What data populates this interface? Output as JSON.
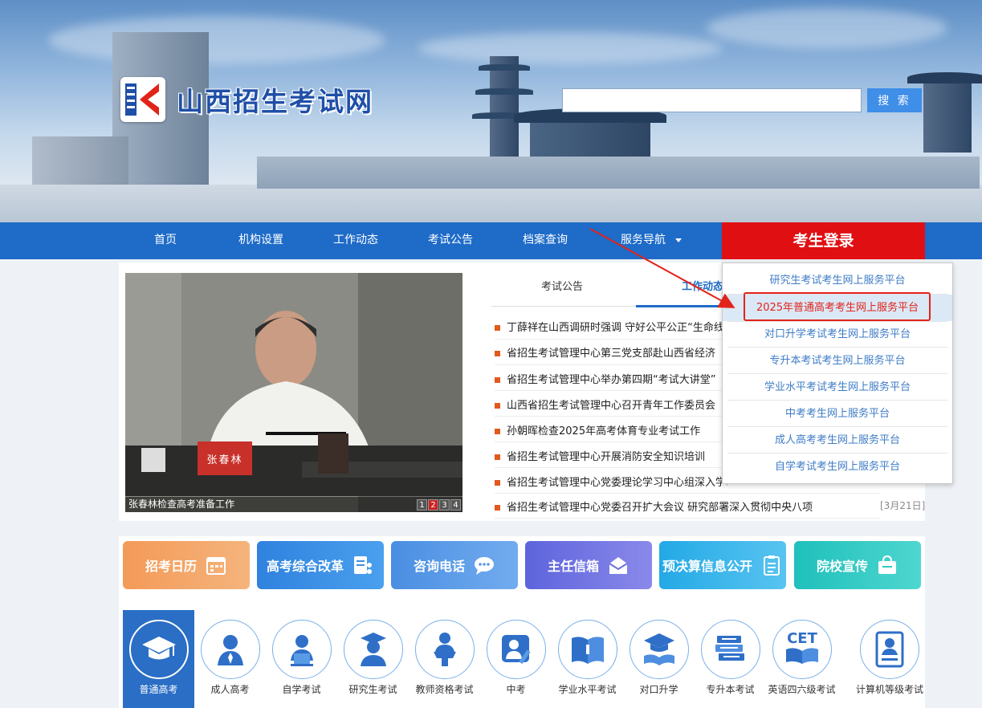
{
  "site": {
    "title": "山西招生考试网"
  },
  "search": {
    "placeholder": "",
    "button_label": "搜 索"
  },
  "nav": {
    "items": [
      "首页",
      "机构设置",
      "工作动态",
      "考试公告",
      "档案查询",
      "服务导航"
    ],
    "login_label": "考生登录"
  },
  "photo": {
    "caption": "张春林检查高考准备工作",
    "name_card": "张春林",
    "pages": [
      "1",
      "2",
      "3",
      "4"
    ],
    "active_page": "2"
  },
  "tabs": {
    "first": "考试公告",
    "second": "工作动态"
  },
  "news": [
    "丁薛祥在山西调研时强调 守好公平公正“生命线”",
    "省招生考试管理中心第三党支部赴山西省经济",
    "省招生考试管理中心举办第四期“考试大讲堂”",
    "山西省招生考试管理中心召开青年工作委员会",
    "孙朝晖检查2025年高考体育专业考试工作",
    "省招生考试管理中心开展消防安全知识培训",
    "省招生考试管理中心党委理论学习中心组深入学习",
    "省招生考试管理中心党委召开扩大会议 研究部署深入贯彻中央八项"
  ],
  "news_last_date": "[3月21日]",
  "dropdown": {
    "items": [
      "研究生考试考生网上服务平台",
      "2025年普通高考考生网上服务平台",
      "对口升学考试考生网上服务平台",
      "专升本考试考生网上服务平台",
      "学业水平考试考生网上服务平台",
      "中考考生网上服务平台",
      "成人高考考生网上服务平台",
      "自学考试考生网上服务平台"
    ],
    "highlighted_index": 1
  },
  "tiles": [
    {
      "label": "招考日历",
      "icon": "calendar-icon",
      "color": "#f2a766"
    },
    {
      "label": "高考综合改革",
      "icon": "share-doc-icon",
      "color": "#3f8fe0"
    },
    {
      "label": "咨询电话",
      "icon": "chat-icon",
      "color": "#5b9be6"
    },
    {
      "label": "主任信箱",
      "icon": "mail-icon",
      "color": "#6b6fe0"
    },
    {
      "label": "预决算信息公开",
      "icon": "clipboard-icon",
      "color": "#3fb6ea"
    },
    {
      "label": "院校宣传",
      "icon": "bag-icon",
      "color": "#31c9c4"
    }
  ],
  "categories": [
    "普通高考",
    "成人高考",
    "自学考试",
    "研究生考试",
    "教师资格考试",
    "中考",
    "学业水平考试",
    "对口升学",
    "专升本考试",
    "英语四六级考试",
    "计算机等级考试"
  ],
  "category_icon_text": {
    "cet": "CET"
  }
}
